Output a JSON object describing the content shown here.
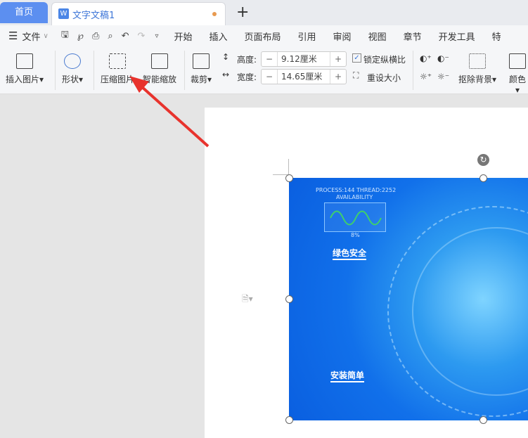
{
  "tabs": {
    "home": "首页",
    "doc": "文字文稿1",
    "new": "+"
  },
  "menu": {
    "file": "文件",
    "items": [
      "开始",
      "插入",
      "页面布局",
      "引用",
      "审阅",
      "视图",
      "章节",
      "开发工具",
      "特"
    ]
  },
  "ribbon": {
    "insert_picture": "插入图片",
    "shape": "形状",
    "compress": "压缩图片",
    "smart_zoom": "智能缩放",
    "crop": "裁剪",
    "height_label": "高度:",
    "height_value": "9.12厘米",
    "width_label": "宽度:",
    "width_value": "14.65厘米",
    "lock_ratio": "锁定纵横比",
    "lock_checked": true,
    "reset_size": "重设大小",
    "remove_bg": "抠除背景",
    "color": "颜色"
  },
  "image": {
    "process": "PROCESS:144  THREAD:2252",
    "availability": "AVAILABILITY",
    "percent": "8%",
    "caption1": "绿色安全",
    "caption2": "安装简单"
  },
  "colors": {
    "accent": "#5c8ff0",
    "arrow": "#e8332d"
  }
}
